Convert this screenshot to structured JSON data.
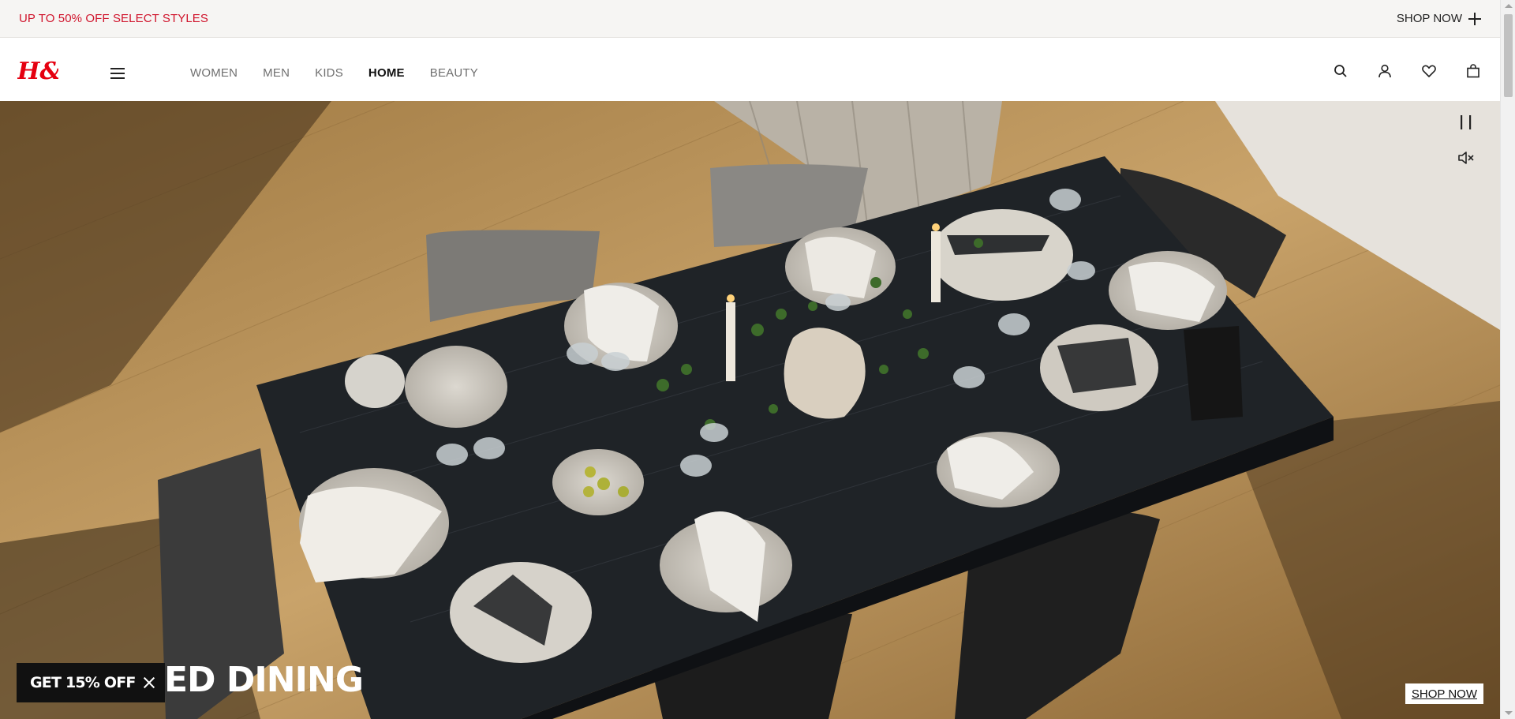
{
  "promo": {
    "text": "UP TO 50% OFF SELECT STYLES",
    "cta": "SHOP NOW",
    "text_color": "#d0142c"
  },
  "header": {
    "logo": "H&M",
    "logo_color": "#e50010",
    "menu_icon": "hamburger-icon",
    "nav": [
      "WOMEN",
      "MEN",
      "KIDS",
      "HOME",
      "BEAUTY"
    ],
    "active_nav": "HOME",
    "icons": [
      "search-icon",
      "account-icon",
      "heart-icon",
      "bag-icon"
    ]
  },
  "hero": {
    "title": "ED DINING",
    "cta": "SHOP NOW",
    "controls": [
      "pause-icon",
      "mute-icon"
    ]
  },
  "discount": {
    "label": "GET 15% OFF",
    "close_icon": "close-icon"
  }
}
